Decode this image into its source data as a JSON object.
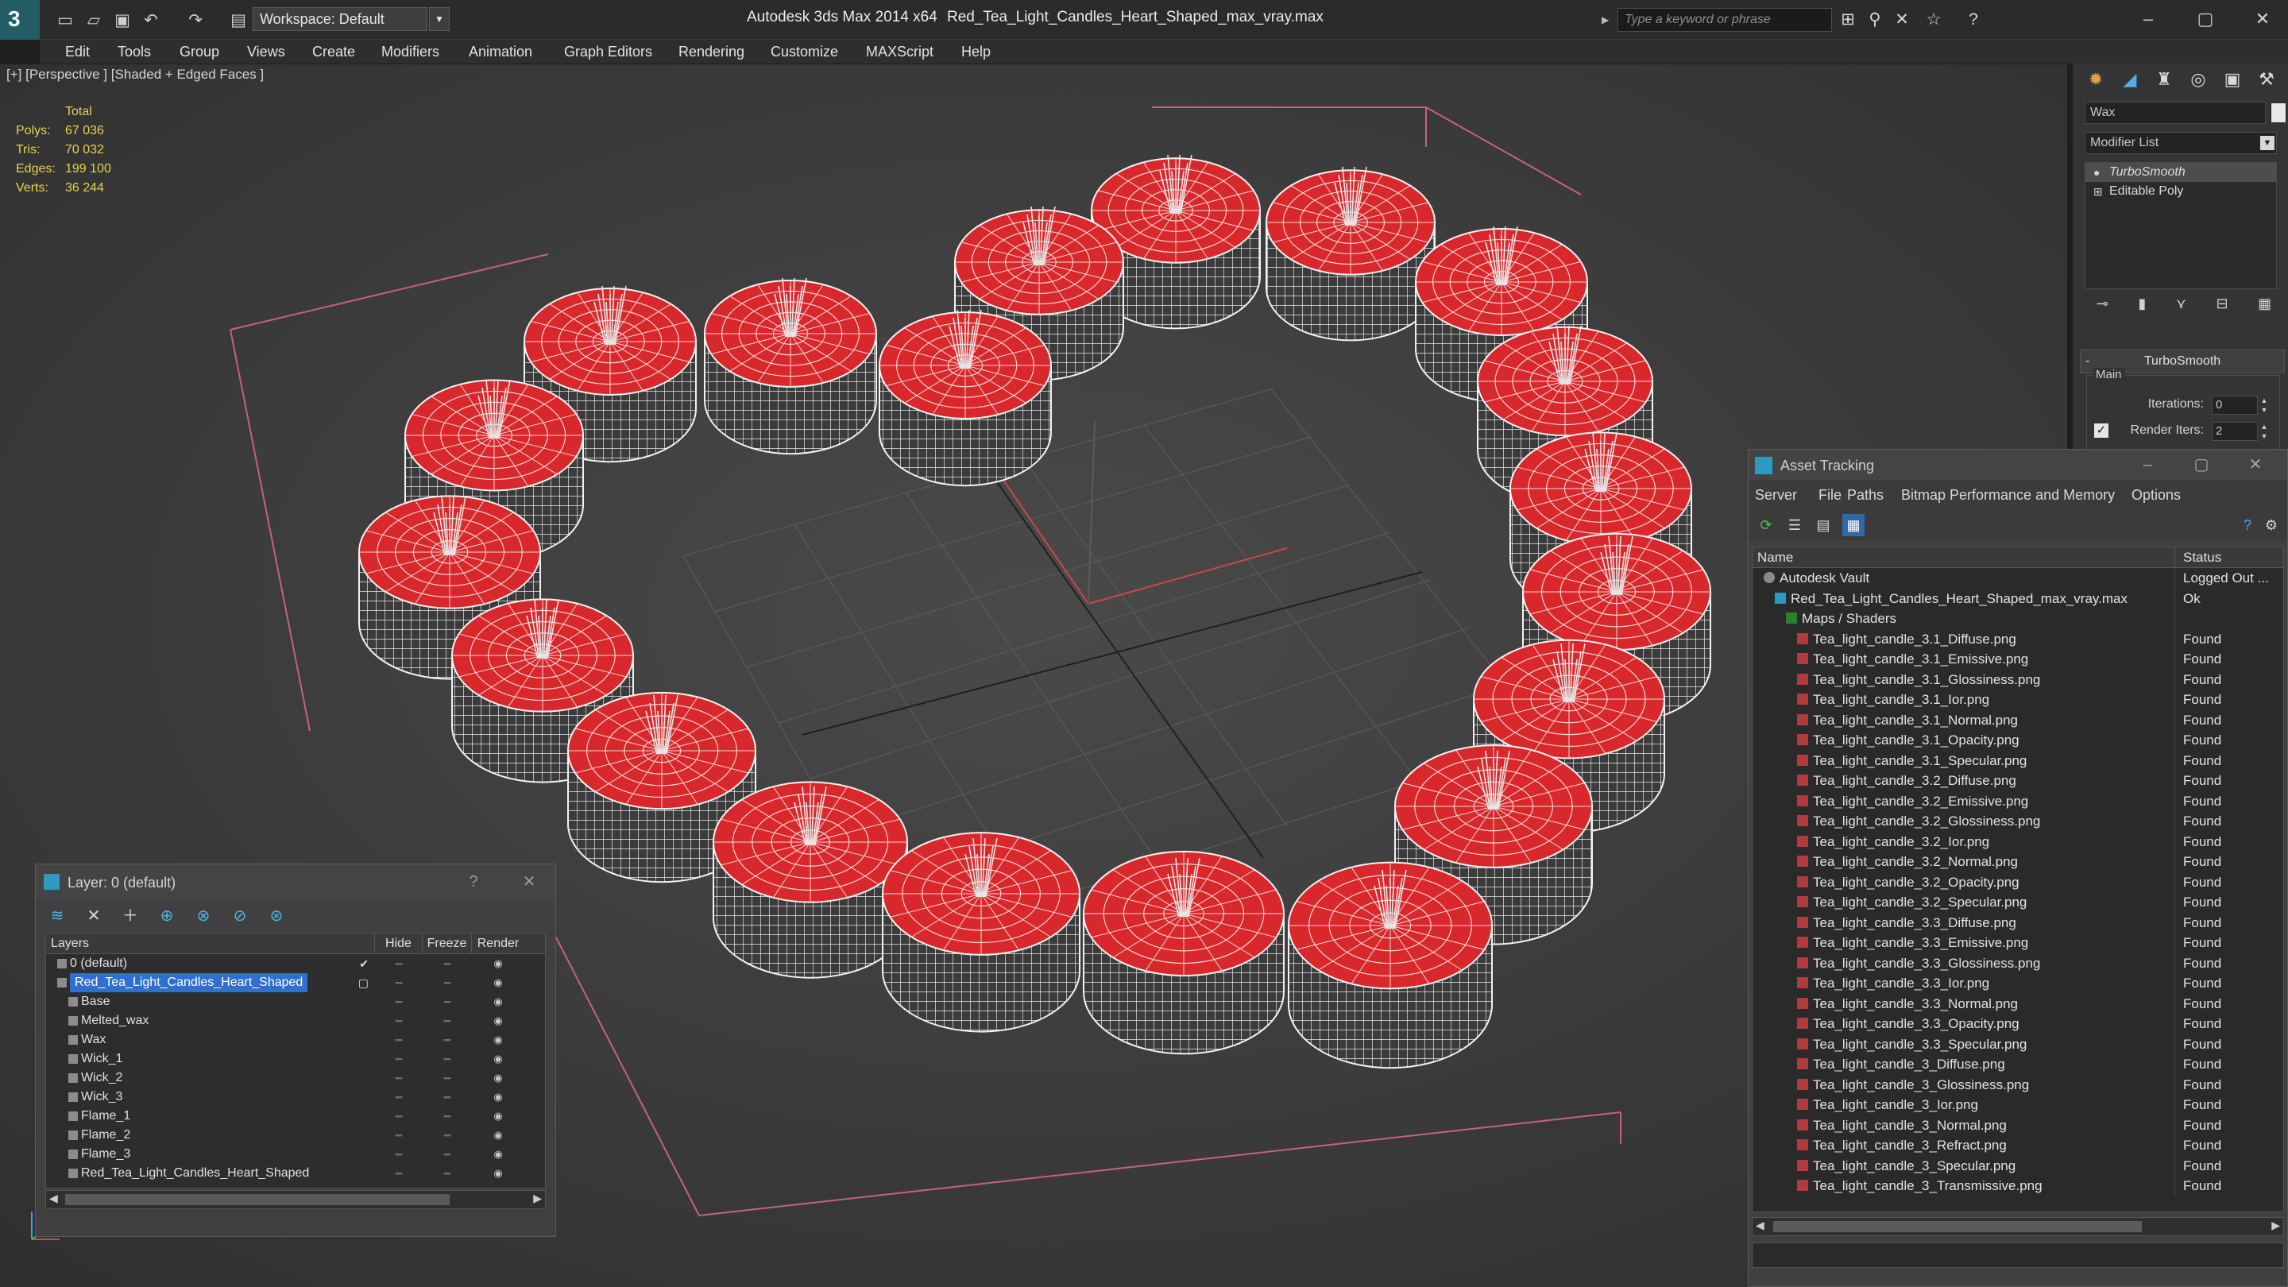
{
  "app": {
    "title": "Autodesk 3ds Max  2014 x64",
    "file": "Red_Tea_Light_Candles_Heart_Shaped_max_vray.max",
    "logo": "3"
  },
  "toolbar": {
    "workspace_label": "Workspace: Default",
    "search_placeholder": "Type a keyword or phrase"
  },
  "menu": [
    "Edit",
    "Tools",
    "Group",
    "Views",
    "Create",
    "Modifiers",
    "Animation",
    "Graph Editors",
    "Rendering",
    "Customize",
    "MAXScript",
    "Help"
  ],
  "viewport": {
    "label": "[+] [Perspective ] [Shaded + Edged Faces ]",
    "stats": {
      "header": "Total",
      "rows": [
        {
          "k": "Polys:",
          "v": "67 036"
        },
        {
          "k": "Tris:",
          "v": "70 032"
        },
        {
          "k": "Edges:",
          "v": "199 100"
        },
        {
          "k": "Verts:",
          "v": "36 244"
        }
      ]
    },
    "candle_color": "#d9282c"
  },
  "command_panel": {
    "object_name": "Wax",
    "modifier_list": "Modifier List",
    "stack": [
      "TurboSmooth",
      "Editable Poly"
    ],
    "rollout_title": "TurboSmooth",
    "group_label": "Main",
    "iterations_label": "Iterations:",
    "iterations_value": "0",
    "render_iters_label": "Render Iters:",
    "render_iters_value": "2"
  },
  "asset_tracking": {
    "title": "Asset Tracking",
    "menu": [
      "Server",
      "File",
      "Paths",
      "Bitmap Performance and Memory",
      "Options"
    ],
    "col_name": "Name",
    "col_status": "Status",
    "rows": [
      {
        "name": "Autodesk Vault",
        "status": "Logged Out ...",
        "indent": 0,
        "icon": "vault"
      },
      {
        "name": "Red_Tea_Light_Candles_Heart_Shaped_max_vray.max",
        "status": "Ok",
        "indent": 1,
        "icon": "max"
      },
      {
        "name": "Maps / Shaders",
        "status": "",
        "indent": 2,
        "icon": "folder"
      },
      {
        "name": "Tea_light_candle_3.1_Diffuse.png",
        "status": "Found",
        "indent": 3,
        "icon": "png"
      },
      {
        "name": "Tea_light_candle_3.1_Emissive.png",
        "status": "Found",
        "indent": 3,
        "icon": "png"
      },
      {
        "name": "Tea_light_candle_3.1_Glossiness.png",
        "status": "Found",
        "indent": 3,
        "icon": "png"
      },
      {
        "name": "Tea_light_candle_3.1_Ior.png",
        "status": "Found",
        "indent": 3,
        "icon": "png"
      },
      {
        "name": "Tea_light_candle_3.1_Normal.png",
        "status": "Found",
        "indent": 3,
        "icon": "png"
      },
      {
        "name": "Tea_light_candle_3.1_Opacity.png",
        "status": "Found",
        "indent": 3,
        "icon": "png"
      },
      {
        "name": "Tea_light_candle_3.1_Specular.png",
        "status": "Found",
        "indent": 3,
        "icon": "png"
      },
      {
        "name": "Tea_light_candle_3.2_Diffuse.png",
        "status": "Found",
        "indent": 3,
        "icon": "png"
      },
      {
        "name": "Tea_light_candle_3.2_Emissive.png",
        "status": "Found",
        "indent": 3,
        "icon": "png"
      },
      {
        "name": "Tea_light_candle_3.2_Glossiness.png",
        "status": "Found",
        "indent": 3,
        "icon": "png"
      },
      {
        "name": "Tea_light_candle_3.2_Ior.png",
        "status": "Found",
        "indent": 3,
        "icon": "png"
      },
      {
        "name": "Tea_light_candle_3.2_Normal.png",
        "status": "Found",
        "indent": 3,
        "icon": "png"
      },
      {
        "name": "Tea_light_candle_3.2_Opacity.png",
        "status": "Found",
        "indent": 3,
        "icon": "png"
      },
      {
        "name": "Tea_light_candle_3.2_Specular.png",
        "status": "Found",
        "indent": 3,
        "icon": "png"
      },
      {
        "name": "Tea_light_candle_3.3_Diffuse.png",
        "status": "Found",
        "indent": 3,
        "icon": "png"
      },
      {
        "name": "Tea_light_candle_3.3_Emissive.png",
        "status": "Found",
        "indent": 3,
        "icon": "png"
      },
      {
        "name": "Tea_light_candle_3.3_Glossiness.png",
        "status": "Found",
        "indent": 3,
        "icon": "png"
      },
      {
        "name": "Tea_light_candle_3.3_Ior.png",
        "status": "Found",
        "indent": 3,
        "icon": "png"
      },
      {
        "name": "Tea_light_candle_3.3_Normal.png",
        "status": "Found",
        "indent": 3,
        "icon": "png"
      },
      {
        "name": "Tea_light_candle_3.3_Opacity.png",
        "status": "Found",
        "indent": 3,
        "icon": "png"
      },
      {
        "name": "Tea_light_candle_3.3_Specular.png",
        "status": "Found",
        "indent": 3,
        "icon": "png"
      },
      {
        "name": "Tea_light_candle_3_Diffuse.png",
        "status": "Found",
        "indent": 3,
        "icon": "png"
      },
      {
        "name": "Tea_light_candle_3_Glossiness.png",
        "status": "Found",
        "indent": 3,
        "icon": "png"
      },
      {
        "name": "Tea_light_candle_3_Ior.png",
        "status": "Found",
        "indent": 3,
        "icon": "png"
      },
      {
        "name": "Tea_light_candle_3_Normal.png",
        "status": "Found",
        "indent": 3,
        "icon": "png"
      },
      {
        "name": "Tea_light_candle_3_Refract.png",
        "status": "Found",
        "indent": 3,
        "icon": "png"
      },
      {
        "name": "Tea_light_candle_3_Specular.png",
        "status": "Found",
        "indent": 3,
        "icon": "png"
      },
      {
        "name": "Tea_light_candle_3_Transmissive.png",
        "status": "Found",
        "indent": 3,
        "icon": "png"
      }
    ]
  },
  "layer_explorer": {
    "title": "Layer: 0 (default)",
    "col_layers": "Layers",
    "col_hide": "Hide",
    "col_freeze": "Freeze",
    "col_render": "Render",
    "rows": [
      {
        "name": "0 (default)",
        "indent": 1,
        "check": "✔",
        "selected": false
      },
      {
        "name": "Red_Tea_Light_Candles_Heart_Shaped",
        "indent": 1,
        "check": "▢",
        "selected": true
      },
      {
        "name": "Base",
        "indent": 2,
        "check": "",
        "selected": false
      },
      {
        "name": "Melted_wax",
        "indent": 2,
        "check": "",
        "selected": false
      },
      {
        "name": "Wax",
        "indent": 2,
        "check": "",
        "selected": false
      },
      {
        "name": "Wick_1",
        "indent": 2,
        "check": "",
        "selected": false
      },
      {
        "name": "Wick_2",
        "indent": 2,
        "check": "",
        "selected": false
      },
      {
        "name": "Wick_3",
        "indent": 2,
        "check": "",
        "selected": false
      },
      {
        "name": "Flame_1",
        "indent": 2,
        "check": "",
        "selected": false
      },
      {
        "name": "Flame_2",
        "indent": 2,
        "check": "",
        "selected": false
      },
      {
        "name": "Flame_3",
        "indent": 2,
        "check": "",
        "selected": false
      },
      {
        "name": "Red_Tea_Light_Candles_Heart_Shaped",
        "indent": 2,
        "check": "",
        "selected": false
      }
    ]
  }
}
